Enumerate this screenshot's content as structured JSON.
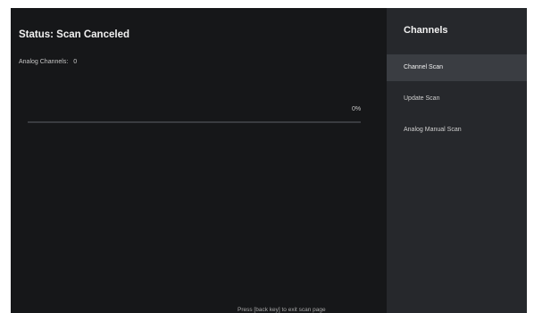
{
  "status": {
    "title": "Status: Scan Canceled",
    "analog_label": "Analog Channels:",
    "analog_count": "0"
  },
  "progress": {
    "percent_label": "0%",
    "value": 0
  },
  "footer": {
    "hint": "Press [back key] to exit scan page"
  },
  "channels_menu": {
    "title": "Channels",
    "items": [
      {
        "label": "Channel Scan",
        "selected": true
      },
      {
        "label": "Update Scan",
        "selected": false
      },
      {
        "label": "Analog Manual Scan",
        "selected": false
      }
    ]
  },
  "colors": {
    "background": "#161719",
    "side_panel": "#26282c",
    "selected_item": "#3a3d42",
    "progress_track": "#3a3c40",
    "progress_fill": "#8ab4f8"
  }
}
